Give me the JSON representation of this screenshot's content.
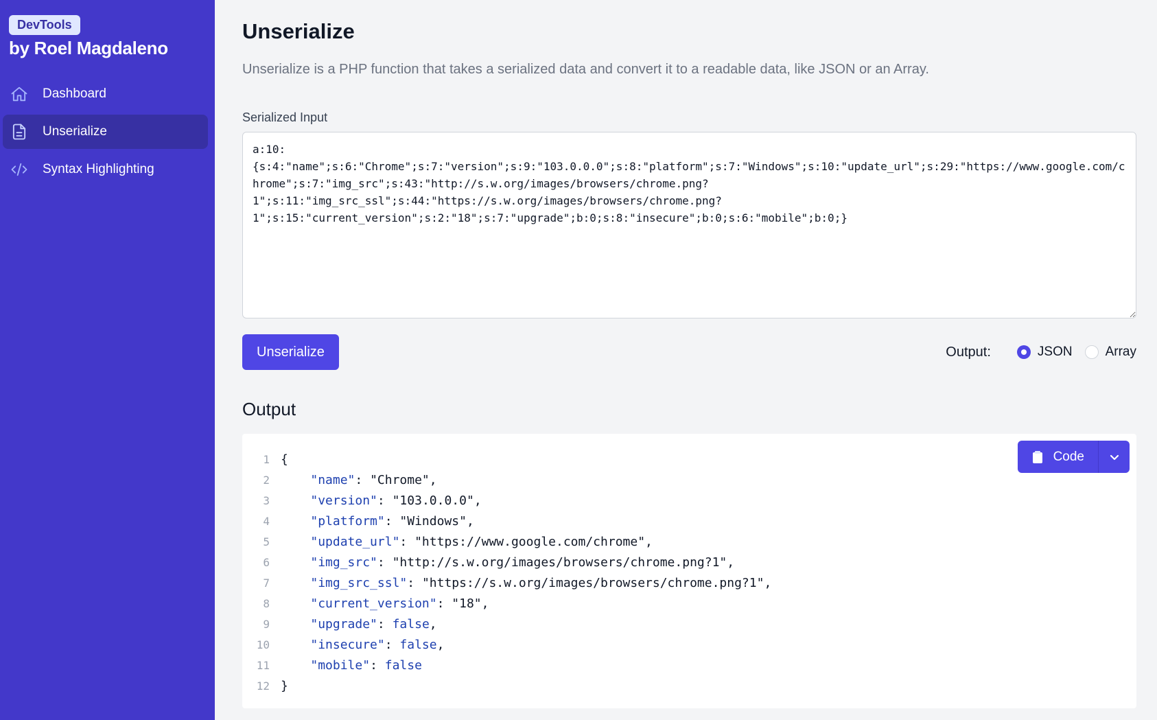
{
  "sidebar": {
    "badge": "DevTools",
    "author": "by Roel Magdaleno",
    "items": [
      {
        "label": "Dashboard",
        "icon": "home-icon",
        "active": false
      },
      {
        "label": "Unserialize",
        "icon": "document-icon",
        "active": true
      },
      {
        "label": "Syntax Highlighting",
        "icon": "code-icon",
        "active": false
      }
    ]
  },
  "main": {
    "title": "Unserialize",
    "description": "Unserialize is a PHP function that takes a serialized data and convert it to a readable data, like JSON or an Array.",
    "input_label": "Serialized Input",
    "input_value": "a:10:\n{s:4:\"name\";s:6:\"Chrome\";s:7:\"version\";s:9:\"103.0.0.0\";s:8:\"platform\";s:7:\"Windows\";s:10:\"update_url\";s:29:\"https://www.google.com/chrome\";s:7:\"img_src\";s:43:\"http://s.w.org/images/browsers/chrome.png?\n1\";s:11:\"img_src_ssl\";s:44:\"https://s.w.org/images/browsers/chrome.png?\n1\";s:15:\"current_version\";s:2:\"18\";s:7:\"upgrade\";b:0;s:8:\"insecure\";b:0;s:6:\"mobile\";b:0;}",
    "submit_label": "Unserialize",
    "output_options": {
      "label": "Output:",
      "options": [
        {
          "label": "JSON",
          "checked": true
        },
        {
          "label": "Array",
          "checked": false
        }
      ]
    },
    "output_title": "Output",
    "code_button_label": "Code",
    "code_lines": [
      {
        "num": "1",
        "code": "{"
      },
      {
        "num": "2",
        "code": "    \"name\": \"Chrome\","
      },
      {
        "num": "3",
        "code": "    \"version\": \"103.0.0.0\","
      },
      {
        "num": "4",
        "code": "    \"platform\": \"Windows\","
      },
      {
        "num": "5",
        "code": "    \"update_url\": \"https://www.google.com/chrome\","
      },
      {
        "num": "6",
        "code": "    \"img_src\": \"http://s.w.org/images/browsers/chrome.png?1\","
      },
      {
        "num": "7",
        "code": "    \"img_src_ssl\": \"https://s.w.org/images/browsers/chrome.png?1\","
      },
      {
        "num": "8",
        "code": "    \"current_version\": \"18\","
      },
      {
        "num": "9",
        "code": "    \"upgrade\": false,"
      },
      {
        "num": "10",
        "code": "    \"insecure\": false,"
      },
      {
        "num": "11",
        "code": "    \"mobile\": false"
      },
      {
        "num": "12",
        "code": "}"
      }
    ]
  },
  "colors": {
    "sidebar_bg": "#4338ca",
    "sidebar_active": "#3730a3",
    "primary": "#4f46e5",
    "page_bg": "#f3f4f6"
  }
}
